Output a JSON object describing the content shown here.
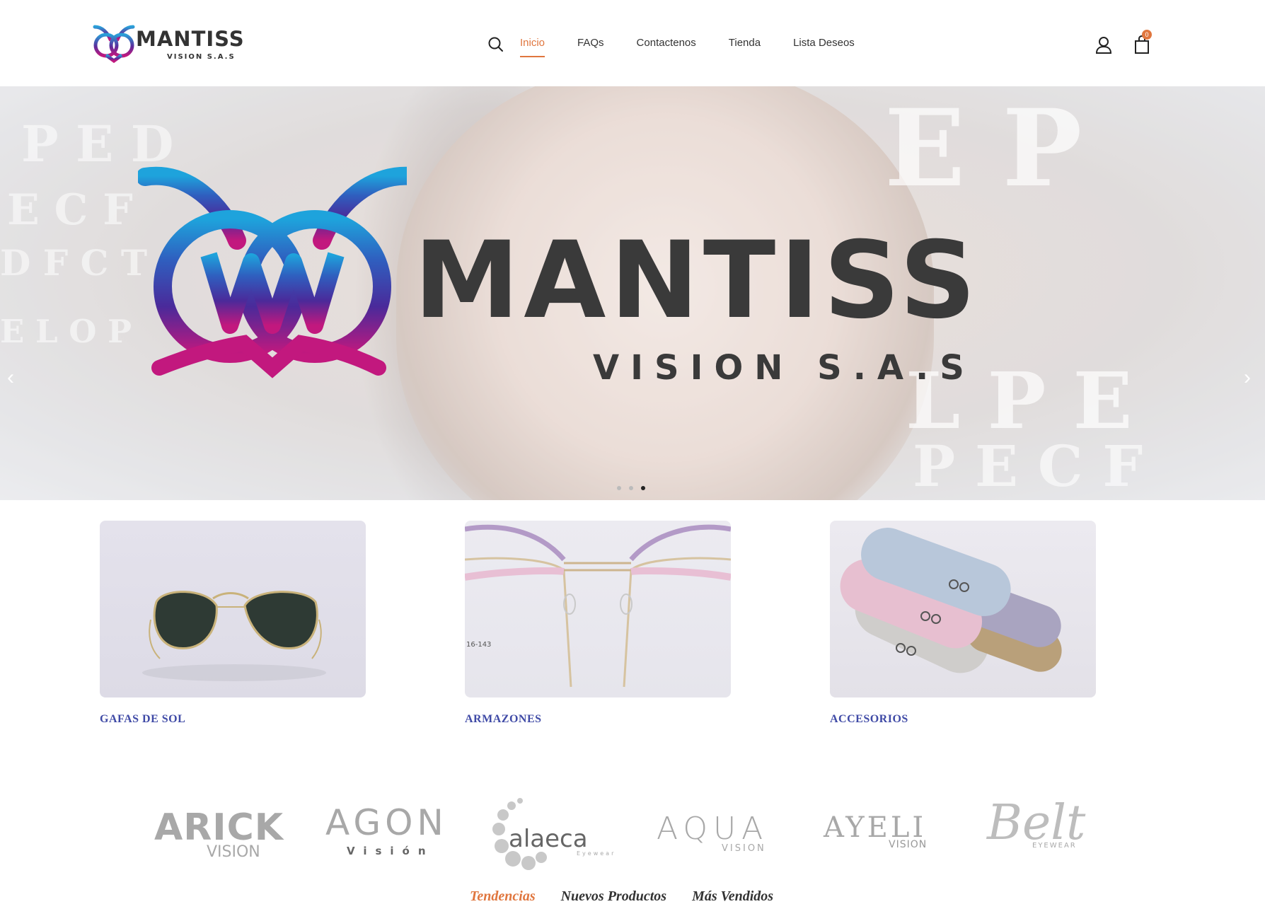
{
  "header": {
    "logo_text": "MANTISS",
    "logo_subtext": "VISION S.A.S",
    "nav": [
      {
        "label": "Inicio",
        "active": true
      },
      {
        "label": "FAQs",
        "active": false
      },
      {
        "label": "Contactenos",
        "active": false
      },
      {
        "label": "Tienda",
        "active": false
      },
      {
        "label": "Lista Deseos",
        "active": false
      }
    ],
    "cart_count": "0",
    "icons": {
      "search": "search-icon",
      "user": "user-icon",
      "cart": "shopping-bag-icon"
    }
  },
  "hero": {
    "title": "MANTISS",
    "subtitle": "VISION S.A.S",
    "slides": 3,
    "active_slide": 3
  },
  "categories": [
    {
      "label": "GAFAS DE SOL"
    },
    {
      "label": "ARMAZONES"
    },
    {
      "label": "ACCESORIOS"
    }
  ],
  "brands": [
    {
      "name": "ARICK",
      "sub": "VISION"
    },
    {
      "name": "AGON",
      "sub": "Visión"
    },
    {
      "name": "alaeca",
      "sub": "Eyewear"
    },
    {
      "name": "AQUA",
      "sub": "VISION"
    },
    {
      "name": "AYELI",
      "sub": "VISION"
    },
    {
      "name": "Belt",
      "sub": "EYEWEAR"
    }
  ],
  "product_tabs": [
    {
      "label": "Tendencias",
      "active": true
    },
    {
      "label": "Nuevos Productos",
      "active": false
    },
    {
      "label": "Más Vendidos",
      "active": false
    }
  ],
  "colors": {
    "accent": "#e0763e",
    "category_link": "#3f4aa6",
    "logo_blue": "#2a9fd8",
    "logo_purple": "#5a2d9c",
    "logo_pink": "#c2187e"
  }
}
